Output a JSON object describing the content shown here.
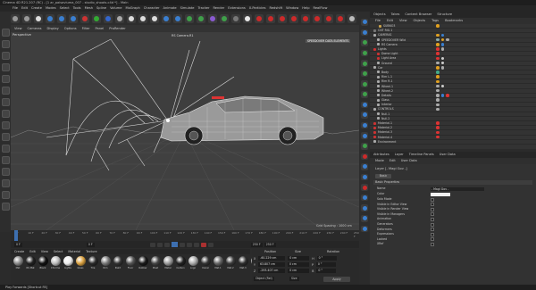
{
  "window": {
    "title": "Cinema 4D R21.207 (RC) - [1 ar_paisaviuma_007 - studio_shoots.c4d *] - Main"
  },
  "menubar": [
    "File",
    "Edit",
    "Create",
    "Modes",
    "Select",
    "Tools",
    "Mesh",
    "Spline",
    "Volume",
    "MoGraph",
    "Character",
    "Animate",
    "Simulate",
    "Tracker",
    "Render",
    "Extensions",
    "X-Particles",
    "Redshift",
    "Window",
    "Help",
    "RealFlow"
  ],
  "viewport": {
    "menu": [
      "View",
      "Cameras",
      "Display",
      "Options",
      "Filter",
      "Panel",
      "ProRender"
    ],
    "projection_label": "Perspective",
    "camera_label": "RS Camera.R1",
    "overlay_label": "SPEEDOVER DATA ELEMENTS",
    "grid_spacing": "Grid Spacing : 1000 cm"
  },
  "objects": {
    "tabs": [
      "Objects",
      "Takes",
      "Content Browser",
      "Structure"
    ],
    "menu": [
      "File",
      "Edit",
      "View",
      "Objects",
      "Tags",
      "Bookmarks"
    ],
    "rows": [
      {
        "name": "SUBNO3",
        "color": "#c9a24a",
        "indent": 10,
        "tags": [
          "#e0a020"
        ]
      },
      {
        "name": "CNT RIG.1",
        "color": "#777",
        "indent": 4,
        "tags": []
      },
      {
        "name": "CAMERAS",
        "color": "#aaa",
        "indent": 4,
        "tags": [
          "#e0a020",
          "#3a7fd0"
        ]
      },
      {
        "name": "SPEEDOVER Wild",
        "color": "#aaa",
        "indent": 8,
        "tags": [
          "#8aa",
          "#e0a020",
          "#aaa"
        ]
      },
      {
        "name": "RS Camera",
        "color": "#aaa",
        "indent": 8,
        "tags": [
          "#e0a020",
          "#3a7fd0"
        ]
      },
      {
        "name": "Lights",
        "color": "#c33",
        "indent": 4,
        "tags": [
          "#d33",
          "#aaa"
        ]
      },
      {
        "name": "Dome Light",
        "color": "#c33",
        "indent": 8,
        "tags": [
          "#d33"
        ]
      },
      {
        "name": "Light Area",
        "color": "#c33",
        "indent": 8,
        "tags": [
          "#d33",
          "#ccc"
        ]
      },
      {
        "name": "Ground",
        "color": "#aaa",
        "indent": 8,
        "tags": [
          "#aaa",
          "#ccc"
        ]
      },
      {
        "name": "Car",
        "color": "#aaa",
        "indent": 4,
        "tags": [
          "#e0a020",
          "#aaa"
        ]
      },
      {
        "name": "Body",
        "color": "#aaa",
        "indent": 8,
        "tags": [
          "#4a8"
        ]
      },
      {
        "name": "Rim L.1",
        "color": "#aaa",
        "indent": 8,
        "tags": [
          "#e0a020"
        ]
      },
      {
        "name": "Rim R.1",
        "color": "#aaa",
        "indent": 8,
        "tags": [
          "#e0a020"
        ]
      },
      {
        "name": "Wheel.1",
        "color": "#aaa",
        "indent": 8,
        "tags": [
          "#aaa",
          "#ccc"
        ]
      },
      {
        "name": "Wheel.2",
        "color": "#aaa",
        "indent": 8,
        "tags": [
          "#aaa"
        ]
      },
      {
        "name": "Details",
        "color": "#aaa",
        "indent": 8,
        "tags": [
          "#aaa",
          "#3a7fd0",
          "#d33"
        ]
      },
      {
        "name": "Glass",
        "color": "#aaa",
        "indent": 8,
        "tags": [
          "#aaa"
        ]
      },
      {
        "name": "Interior",
        "color": "#aaa",
        "indent": 8,
        "tags": [
          "#aaa"
        ]
      },
      {
        "name": "CONTROLS",
        "color": "#aaa",
        "indent": 4,
        "tags": [
          "#aaa"
        ]
      },
      {
        "name": "Null.1",
        "color": "#aaa",
        "indent": 8,
        "tags": []
      },
      {
        "name": "Null.2",
        "color": "#aaa",
        "indent": 8,
        "tags": []
      },
      {
        "name": "Material.1",
        "color": "#c33",
        "indent": 4,
        "tags": [
          "#d33"
        ]
      },
      {
        "name": "Material.2",
        "color": "#c33",
        "indent": 4,
        "tags": [
          "#d33"
        ]
      },
      {
        "name": "Material.3",
        "color": "#c33",
        "indent": 4,
        "tags": [
          "#d33"
        ]
      },
      {
        "name": "Material.4",
        "color": "#c33",
        "indent": 4,
        "tags": [
          "#d33"
        ]
      },
      {
        "name": "Environment",
        "color": "#aaa",
        "indent": 4,
        "tags": []
      }
    ]
  },
  "attributes": {
    "tabs": [
      "Attributes",
      "Layer",
      "Timeline Panels",
      "User Data"
    ],
    "menu": [
      "Mode",
      "Edit",
      "User Data"
    ],
    "header": "Layer [- Magi Gov -]",
    "tab_basic": "Basic",
    "section": "Basic Properties",
    "name_label": "Name",
    "name_value": "- Magi Gov -",
    "color_label": "Color",
    "checks": [
      "Solo Mode",
      "Visible in Editor View",
      "Visible in Render View",
      "Visible in Managers",
      "Animation",
      "Generators",
      "Deformers",
      "Expressions",
      "Locked",
      "XRef"
    ]
  },
  "timeline": {
    "ticks": [
      "0 F",
      "10 F",
      "20 F",
      "30 F",
      "40 F",
      "50 F",
      "60 F",
      "70 F",
      "80 F",
      "90 F",
      "100 F",
      "110 F",
      "120 F",
      "130 F",
      "140 F",
      "150 F",
      "160 F",
      "170 F",
      "180 F",
      "190 F",
      "200 F",
      "210 F",
      "220 F",
      "230 F",
      "240 F",
      "250 F"
    ],
    "start_frame": "0 F",
    "current_frame": "0 F",
    "end_frame": "250 F",
    "preview_end": "250 F"
  },
  "materials": {
    "menu": [
      "Create",
      "Edit",
      "View",
      "Select",
      "Material",
      "Texture"
    ],
    "items": [
      {
        "label": "Mat",
        "color": "#888"
      },
      {
        "label": "RS Mat",
        "color": "#222"
      },
      {
        "label": "Black",
        "color": "#111"
      },
      {
        "label": "Chrome",
        "color": "#bbb"
      },
      {
        "label": "Lights",
        "color": "#eee"
      },
      {
        "label": "Glass",
        "color": "#d8a040"
      },
      {
        "label": "Tire",
        "color": "#2a2a2a"
      },
      {
        "label": "Rim",
        "color": "#777"
      },
      {
        "label": "Paint",
        "color": "#333"
      },
      {
        "label": "Floor",
        "color": "#555"
      },
      {
        "label": "Rubber",
        "color": "#1a1a1a"
      },
      {
        "label": "Plast",
        "color": "#444"
      },
      {
        "label": "Metal",
        "color": "#999"
      },
      {
        "label": "Carbon",
        "color": "#222"
      },
      {
        "label": "Logo",
        "color": "#aaa"
      },
      {
        "label": "Decal",
        "color": "#333"
      },
      {
        "label": "Mat.1",
        "color": "#666"
      },
      {
        "label": "Mat.2",
        "color": "#3a3a3a"
      },
      {
        "label": "Mat.3",
        "color": "#2e2e2e"
      },
      {
        "label": "Mat.4",
        "color": "#888"
      }
    ]
  },
  "coordinates": {
    "headers": [
      "Position",
      "Size",
      "Rotation"
    ],
    "rows": [
      {
        "axis": "X",
        "pos": "-60.229 cm",
        "size": "0 cm",
        "rot_axis": "H",
        "rot": "0 °"
      },
      {
        "axis": "Y",
        "pos": "63.807 cm",
        "size": "0 cm",
        "rot_axis": "P",
        "rot": "0 °"
      },
      {
        "axis": "Z",
        "pos": "-293.407 cm",
        "size": "0 cm",
        "rot_axis": "B",
        "rot": "0 °"
      }
    ],
    "mode_left": "Object (Rel)",
    "mode_mid": "Size",
    "apply": "Apply"
  },
  "status": {
    "text": "Play Forwards [Shortcut F8]"
  },
  "colors": {
    "accent": "#3d6fb0",
    "toolbar_red": "#cc2a2a",
    "toolbar_green": "#3fa04a"
  }
}
